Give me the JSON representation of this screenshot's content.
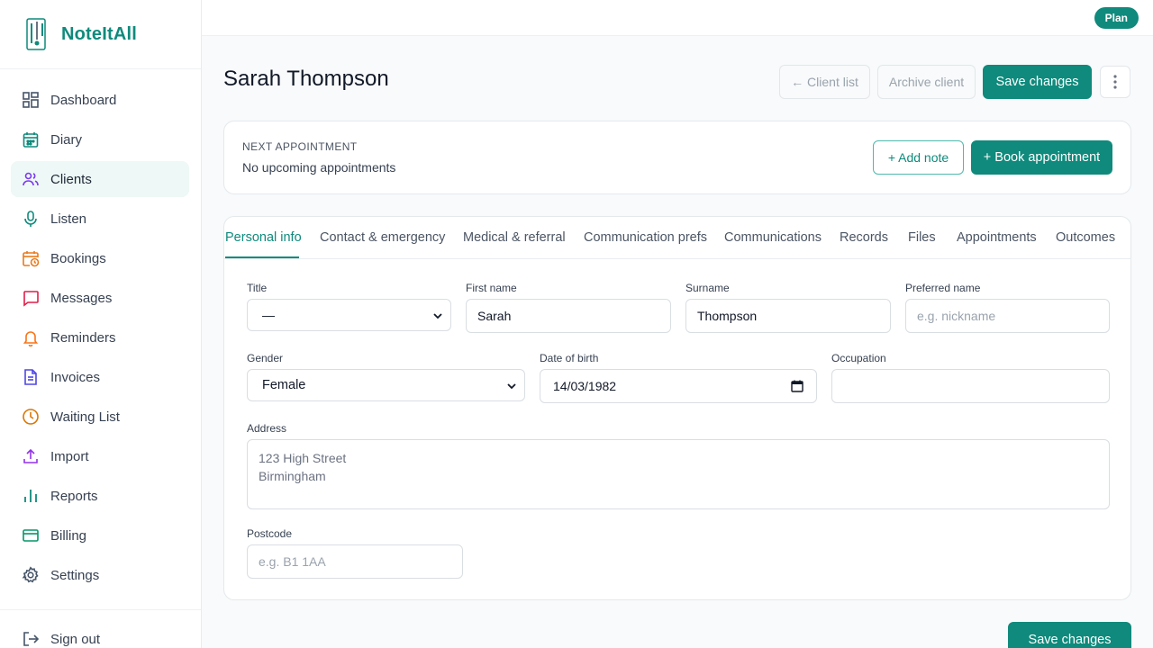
{
  "app": {
    "name": "NoteItAll",
    "plan_label": "Plan"
  },
  "sidebar": {
    "items": [
      {
        "label": "Dashboard",
        "icon": "dashboard-icon"
      },
      {
        "label": "Diary",
        "icon": "calendar-icon"
      },
      {
        "label": "Clients",
        "icon": "users-icon",
        "active": true
      },
      {
        "label": "Listen",
        "icon": "microphone-icon"
      },
      {
        "label": "Bookings",
        "icon": "calendar-clock-icon"
      },
      {
        "label": "Messages",
        "icon": "message-icon"
      },
      {
        "label": "Reminders",
        "icon": "bell-icon"
      },
      {
        "label": "Invoices",
        "icon": "invoice-icon"
      },
      {
        "label": "Waiting List",
        "icon": "clock-icon"
      },
      {
        "label": "Import",
        "icon": "upload-icon"
      },
      {
        "label": "Reports",
        "icon": "bar-chart-icon"
      },
      {
        "label": "Billing",
        "icon": "credit-card-icon"
      },
      {
        "label": "Settings",
        "icon": "gear-icon"
      }
    ],
    "signout_label": "Sign out"
  },
  "header": {
    "title": "Sarah Thompson",
    "client_list_label": "← Client list",
    "archive_label": "Archive client",
    "save_label": "Save changes",
    "more_icon": "more-vertical-icon"
  },
  "appointment": {
    "label": "NEXT APPOINTMENT",
    "value": "No upcoming appointments",
    "add_note_label": "+ Add note",
    "book_label": "+ Book appointment"
  },
  "tabs": [
    {
      "label": "Personal info",
      "active": true
    },
    {
      "label": "Contact & emergency"
    },
    {
      "label": "Medical & referral"
    },
    {
      "label": "Communication prefs"
    },
    {
      "label": "Communications"
    },
    {
      "label": "Records"
    },
    {
      "label": "Files"
    },
    {
      "label": "Appointments"
    },
    {
      "label": "Outcomes"
    }
  ],
  "form": {
    "title": {
      "label": "Title",
      "value": "—"
    },
    "first_name": {
      "label": "First name",
      "value": "Sarah"
    },
    "surname": {
      "label": "Surname",
      "value": "Thompson"
    },
    "preferred_name": {
      "label": "Preferred name",
      "placeholder": "e.g. nickname"
    },
    "gender": {
      "label": "Gender",
      "value": "Female"
    },
    "dob": {
      "label": "Date of birth",
      "value": "14/03/1982"
    },
    "occupation": {
      "label": "Occupation",
      "value": ""
    },
    "address": {
      "label": "Address",
      "value": "123 High Street\nBirmingham"
    },
    "postcode": {
      "label": "Postcode",
      "placeholder": "e.g. B1 1AA"
    }
  },
  "footer": {
    "save_label": "Save changes"
  },
  "colors": {
    "accent": "#0f8a7c",
    "active_bg": "#eef8f6"
  }
}
